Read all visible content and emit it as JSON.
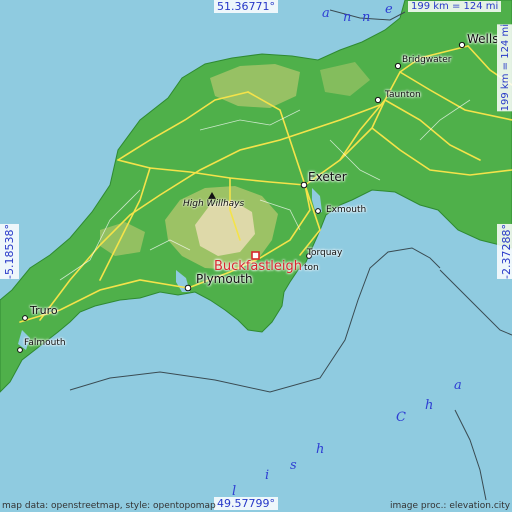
{
  "coords": {
    "north": "51.36771°",
    "south": "49.57799°",
    "west": "-5.18538°",
    "east": "-2.37288°"
  },
  "scale": "199 km = 124 mi",
  "places": {
    "wells": "Wells",
    "bridgwater": "Bridgwater",
    "taunton": "Taunton",
    "exeter": "Exeter",
    "exmouth": "Exmouth",
    "torquay": "Torquay",
    "plymouth": "Plymouth",
    "truro": "Truro",
    "falmouth": "Falmouth",
    "newton_fragment": "ton"
  },
  "peak": "High Willhays",
  "target": "Buckfastleigh",
  "sea_letters": {
    "channel_top": [
      "a",
      "n",
      "n",
      "e"
    ],
    "channel_bottom": [
      "l",
      "i",
      "s",
      "h",
      "C",
      "h",
      "a"
    ]
  },
  "credits": {
    "left": "map data: openstreetmap, style: opentopomap",
    "right": "image proc.: elevation.city"
  },
  "colors": {
    "sea": "#8fcbe0",
    "lowland": "#4fb04a",
    "upland": "#a9c66a",
    "moor": "#e6dcb0",
    "road": "#f4e34a",
    "target": "#d7262e",
    "label_blue": "#2738c8"
  }
}
